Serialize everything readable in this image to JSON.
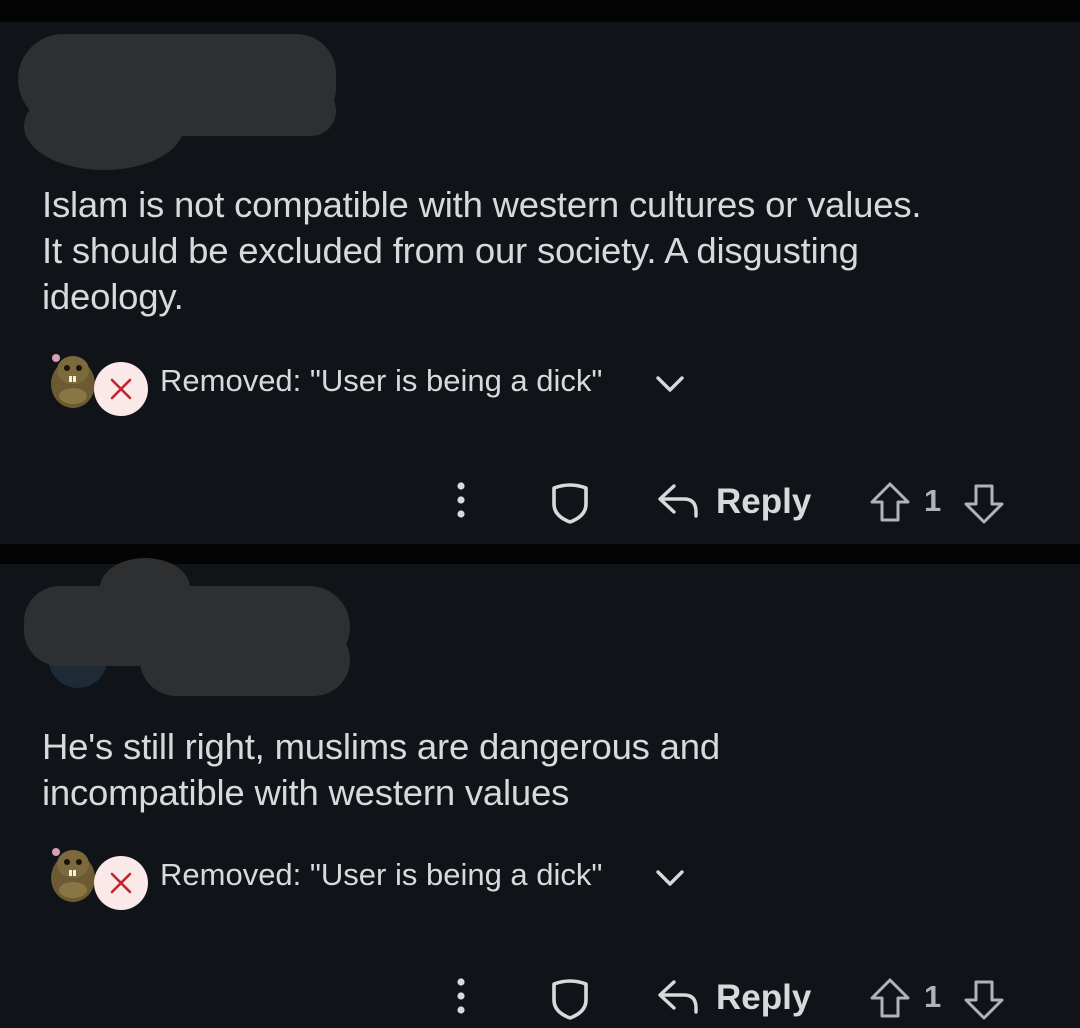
{
  "comments": [
    {
      "body_lines": [
        "Islam is not compatible with western cultures or values.",
        "It should be excluded from our society. A disgusting",
        "ideology."
      ],
      "removal_text": "Removed: \"User is being a dick\"",
      "actions": {
        "reply_label": "Reply",
        "vote_count": "1"
      }
    },
    {
      "body_lines": [
        "He's still right, muslims are dangerous and",
        "incompatible with western values"
      ],
      "removal_text": "Removed: \"User is being a dick\"",
      "actions": {
        "reply_label": "Reply",
        "vote_count": "1"
      }
    }
  ],
  "icons": {
    "removed": "x-circle-icon",
    "expand": "chevron-down-icon",
    "more": "more-vertical-icon",
    "award": "shield-icon",
    "reply": "reply-arrow-icon",
    "upvote": "upvote-arrow-icon",
    "downvote": "downvote-arrow-icon"
  },
  "colors": {
    "background": "#101317",
    "separator": "#040405",
    "text": "#d7dadc",
    "removed_badge_bg": "#fbe8e8",
    "removed_x": "#c0272d"
  }
}
